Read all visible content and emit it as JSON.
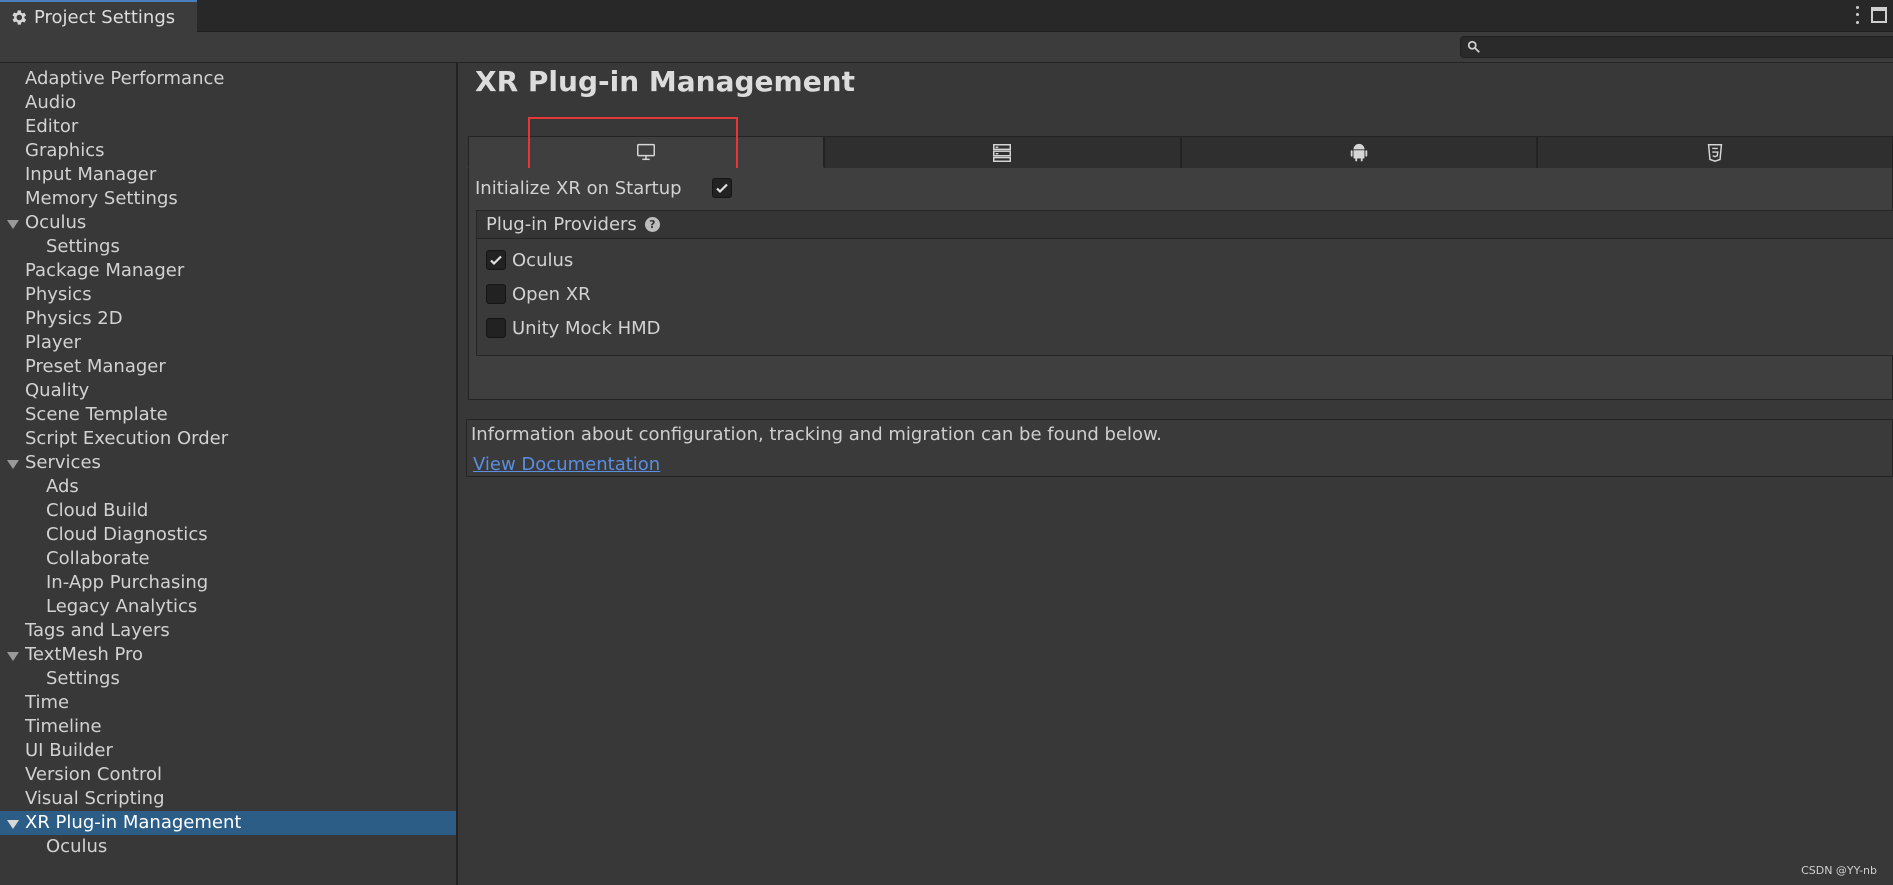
{
  "window": {
    "tab_title": "Project Settings"
  },
  "sidebar": {
    "items": [
      {
        "label": "Adaptive Performance",
        "level": 0
      },
      {
        "label": "Audio",
        "level": 0
      },
      {
        "label": "Editor",
        "level": 0
      },
      {
        "label": "Graphics",
        "level": 0
      },
      {
        "label": "Input Manager",
        "level": 0
      },
      {
        "label": "Memory Settings",
        "level": 0
      },
      {
        "label": "Oculus",
        "level": 0,
        "expanded": true
      },
      {
        "label": "Settings",
        "level": 1
      },
      {
        "label": "Package Manager",
        "level": 0
      },
      {
        "label": "Physics",
        "level": 0
      },
      {
        "label": "Physics 2D",
        "level": 0
      },
      {
        "label": "Player",
        "level": 0
      },
      {
        "label": "Preset Manager",
        "level": 0
      },
      {
        "label": "Quality",
        "level": 0
      },
      {
        "label": "Scene Template",
        "level": 0
      },
      {
        "label": "Script Execution Order",
        "level": 0
      },
      {
        "label": "Services",
        "level": 0,
        "expanded": true
      },
      {
        "label": "Ads",
        "level": 1
      },
      {
        "label": "Cloud Build",
        "level": 1
      },
      {
        "label": "Cloud Diagnostics",
        "level": 1
      },
      {
        "label": "Collaborate",
        "level": 1
      },
      {
        "label": "In-App Purchasing",
        "level": 1
      },
      {
        "label": "Legacy Analytics",
        "level": 1
      },
      {
        "label": "Tags and Layers",
        "level": 0
      },
      {
        "label": "TextMesh Pro",
        "level": 0,
        "expanded": true
      },
      {
        "label": "Settings",
        "level": 1
      },
      {
        "label": "Time",
        "level": 0
      },
      {
        "label": "Timeline",
        "level": 0
      },
      {
        "label": "UI Builder",
        "level": 0
      },
      {
        "label": "Version Control",
        "level": 0
      },
      {
        "label": "Visual Scripting",
        "level": 0
      },
      {
        "label": "XR Plug-in Management",
        "level": 0,
        "expanded": true,
        "selected": true
      },
      {
        "label": "Oculus",
        "level": 1
      }
    ]
  },
  "main": {
    "title": "XR Plug-in Management",
    "platform_tabs": [
      {
        "icon": "monitor-icon",
        "active": true
      },
      {
        "icon": "server-icon",
        "active": false
      },
      {
        "icon": "android-icon",
        "active": false
      },
      {
        "icon": "html5-icon",
        "active": false
      }
    ],
    "init_label": "Initialize XR on Startup",
    "init_checked": true,
    "providers_header": "Plug-in Providers",
    "providers": [
      {
        "label": "Oculus",
        "checked": true
      },
      {
        "label": "Open XR",
        "checked": false
      },
      {
        "label": "Unity Mock HMD",
        "checked": false
      }
    ],
    "info_text": "Information about configuration, tracking and migration can be found below.",
    "doc_link": "View Documentation"
  },
  "watermark": "CSDN @YY-nb",
  "colors": {
    "selection": "#2c5d87",
    "link": "#5b8ee0",
    "highlight": "#e53935"
  }
}
